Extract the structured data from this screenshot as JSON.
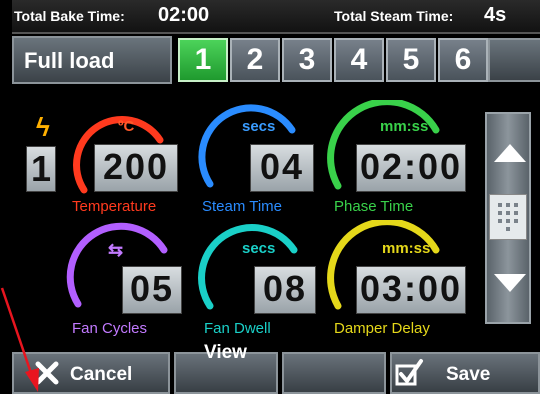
{
  "top_bar": {
    "total_bake_label": "Total Bake Time:",
    "total_bake_value": "02:00",
    "total_steam_label": "Total Steam Time:",
    "total_steam_value": "4s"
  },
  "header": {
    "load_label": "Full load",
    "phases": [
      "1",
      "2",
      "3",
      "4",
      "5",
      "6"
    ],
    "active_phase": "1"
  },
  "side": {
    "power_level": "1"
  },
  "gauges": [
    {
      "id": "temperature",
      "unit": "ºC",
      "value": "200",
      "label": "Temperature",
      "color": "#ff3a1e"
    },
    {
      "id": "steam-time",
      "unit": "secs",
      "value": "04",
      "label": "Steam Time",
      "color": "#2a8cff"
    },
    {
      "id": "phase-time",
      "unit": "mm:ss",
      "value": "02:00",
      "label": "Phase Time",
      "color": "#39d14a"
    },
    {
      "id": "fan-cycles",
      "unit": "⇆",
      "value": "05",
      "label": "Fan Cycles",
      "color": "#b25fff"
    },
    {
      "id": "fan-dwell",
      "unit": "secs",
      "value": "08",
      "label": "Fan Dwell",
      "color": "#1ad0c8"
    },
    {
      "id": "damper-delay",
      "unit": "mm:ss",
      "value": "03:00",
      "label": "Damper Delay",
      "color": "#e5d81a"
    }
  ],
  "bottom_bar": {
    "cancel_label": "Cancel",
    "view_label": "View",
    "save_label": "Save"
  },
  "colors": {
    "annotation_arrow": "#e8151f",
    "active_tab": "#2fb33d",
    "bolt": "#ffb000"
  }
}
